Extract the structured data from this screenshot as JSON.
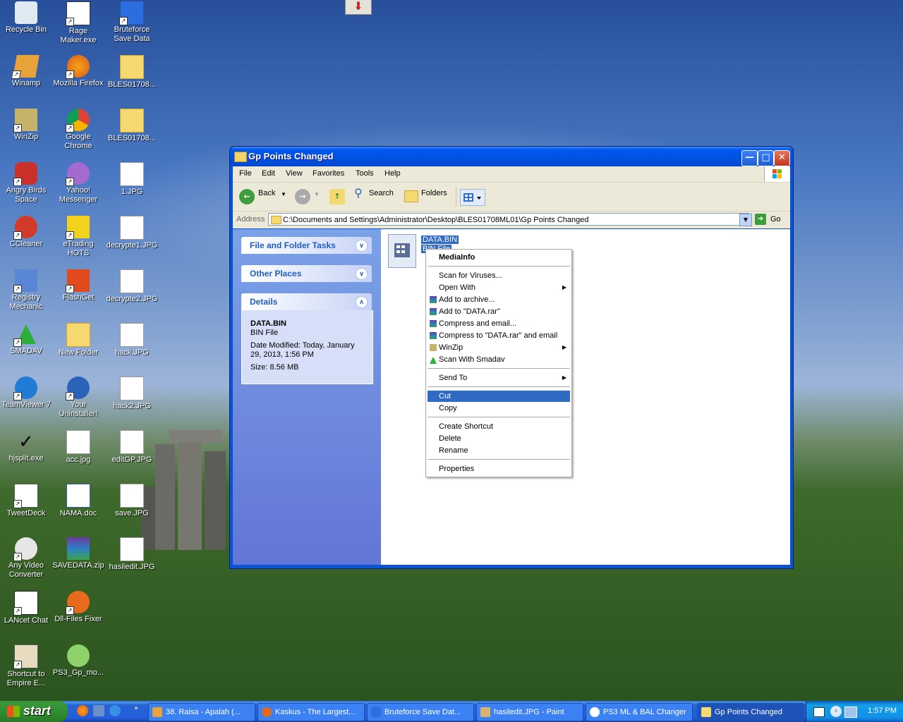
{
  "desktop": {
    "icons": [
      {
        "label": "Recycle Bin"
      },
      {
        "label": "Rage Maker.exe"
      },
      {
        "label": "Bruteforce Save Data"
      },
      {
        "label": "Winamp"
      },
      {
        "label": "Mozilla Firefox"
      },
      {
        "label": "BLES01708..."
      },
      {
        "label": "WinZip"
      },
      {
        "label": "Google Chrome"
      },
      {
        "label": "BLES01708..."
      },
      {
        "label": "Angry Birds Space"
      },
      {
        "label": "Yahoo! Messenger"
      },
      {
        "label": "1.JPG"
      },
      {
        "label": "CCleaner"
      },
      {
        "label": "eTrading HOTS"
      },
      {
        "label": "decrypte1.JPG"
      },
      {
        "label": "Registry Mechanic"
      },
      {
        "label": "FlashGet"
      },
      {
        "label": "decrypte2.JPG"
      },
      {
        "label": "SMADAV"
      },
      {
        "label": "New Folder"
      },
      {
        "label": "hack.JPG"
      },
      {
        "label": "TeamViewer 7"
      },
      {
        "label": "Your Uninstaller!"
      },
      {
        "label": "hack2.JPG"
      },
      {
        "label": "hjsplit.exe"
      },
      {
        "label": "acc.jpg"
      },
      {
        "label": "editGP.JPG"
      },
      {
        "label": "TweetDeck"
      },
      {
        "label": "NAMA.doc"
      },
      {
        "label": "save.JPG"
      },
      {
        "label": "Any Video Converter"
      },
      {
        "label": "SAVEDATA.zip"
      },
      {
        "label": "hasiledit.JPG"
      },
      {
        "label": "LANcet Chat"
      },
      {
        "label": "Dll-Files Fixer"
      },
      {
        "label": "Shortcut to Empire E..."
      },
      {
        "label": "PS3_Gp_mo..."
      }
    ]
  },
  "window": {
    "title": "Gp Points Changed",
    "menu": [
      "File",
      "Edit",
      "View",
      "Favorites",
      "Tools",
      "Help"
    ],
    "toolbar": {
      "back": "Back",
      "search": "Search",
      "folders": "Folders"
    },
    "address": {
      "label": "Address",
      "value": "C:\\Documents and Settings\\Administrator\\Desktop\\BLES01708ML01\\Gp Points Changed",
      "go": "Go"
    },
    "tasks": {
      "file_folder": "File and Folder Tasks",
      "other_places": "Other Places",
      "details": "Details",
      "details_name": "DATA.BIN",
      "details_type": "BIN File",
      "details_modified_1": "Date Modified: Today, January",
      "details_modified_2": "29, 2013, 1:56 PM",
      "details_size": "Size: 8.56 MB"
    },
    "file": {
      "name": "DATA.BIN",
      "type": "BIN File"
    }
  },
  "context_menu": {
    "items": [
      {
        "label": "MediaInfo"
      },
      {
        "label": "Scan for Viruses..."
      },
      {
        "label": "Open With"
      },
      {
        "label": "Add to archive..."
      },
      {
        "label": "Add to \"DATA.rar\""
      },
      {
        "label": "Compress and email..."
      },
      {
        "label": "Compress to \"DATA.rar\" and email"
      },
      {
        "label": "WinZip"
      },
      {
        "label": "Scan With Smadav"
      },
      {
        "label": "Send To"
      },
      {
        "label": "Cut"
      },
      {
        "label": "Copy"
      },
      {
        "label": "Create Shortcut"
      },
      {
        "label": "Delete"
      },
      {
        "label": "Rename"
      },
      {
        "label": "Properties"
      }
    ]
  },
  "taskbar": {
    "start": "start",
    "tasks": [
      {
        "label": "38. Raisa - Apalah (..."
      },
      {
        "label": "Kaskus - The Largest..."
      },
      {
        "label": "Bruteforce Save Dat..."
      },
      {
        "label": "hasiledit.JPG - Paint"
      },
      {
        "label": "PS3 ML & BAL Changer"
      },
      {
        "label": "Gp Points Changed"
      }
    ],
    "clock": "1:57 PM"
  }
}
